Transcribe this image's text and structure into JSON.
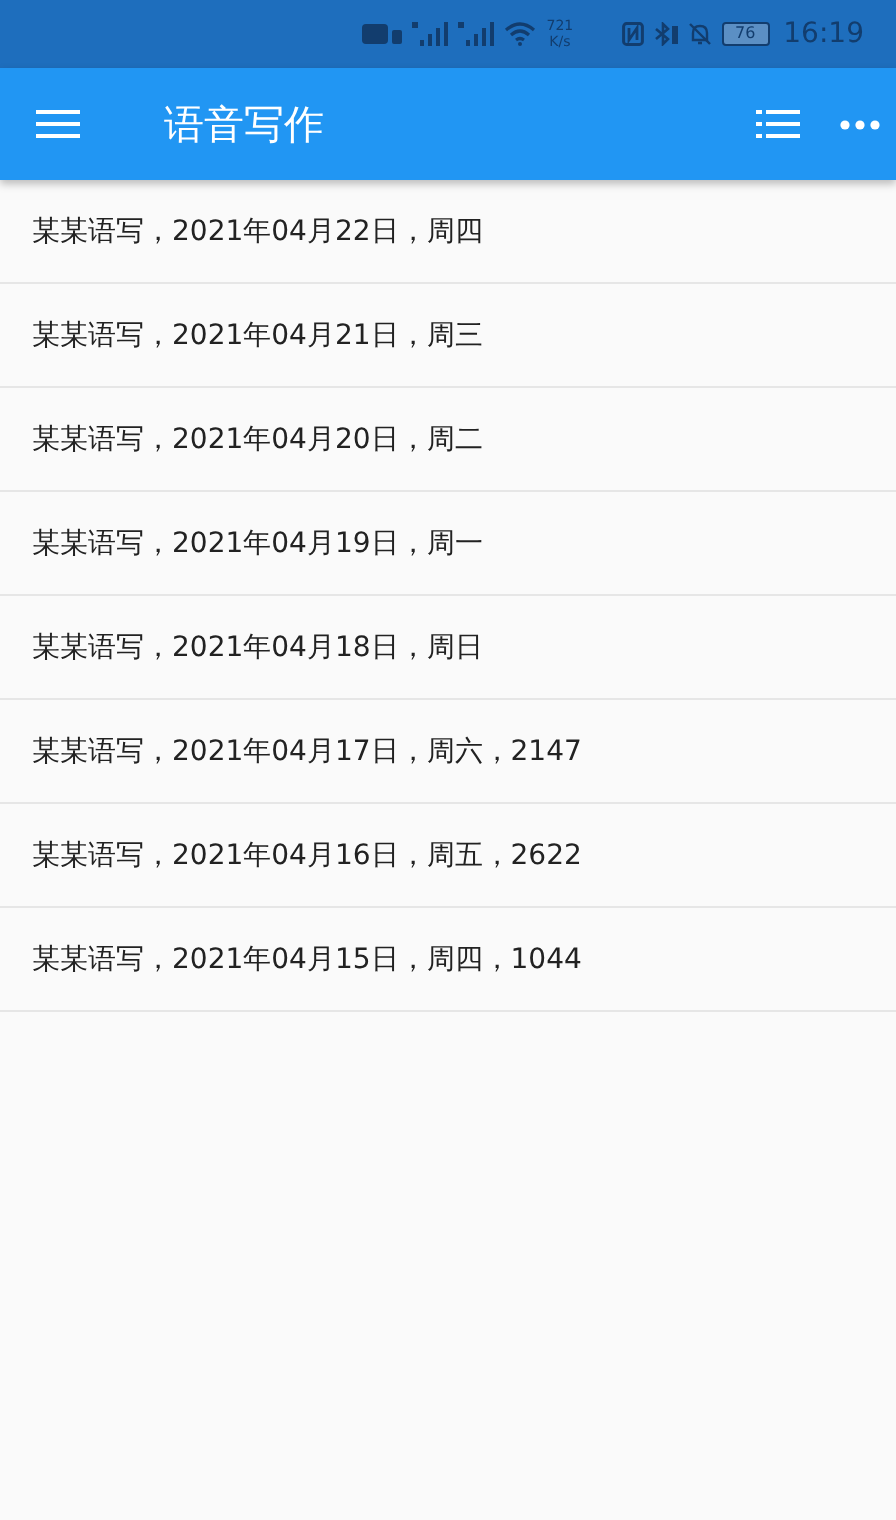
{
  "status_bar": {
    "speed_value": "721",
    "speed_unit": "K/s",
    "battery": "76",
    "time": "16:19"
  },
  "app_bar": {
    "title": "语音写作"
  },
  "entries": [
    {
      "text": "某某语写，2021年04月22日，周四"
    },
    {
      "text": "某某语写，2021年04月21日，周三"
    },
    {
      "text": "某某语写，2021年04月20日，周二"
    },
    {
      "text": "某某语写，2021年04月19日，周一"
    },
    {
      "text": "某某语写，2021年04月18日，周日"
    },
    {
      "text": "某某语写，2021年04月17日，周六，2147"
    },
    {
      "text": "某某语写，2021年04月16日，周五，2622"
    },
    {
      "text": "某某语写，2021年04月15日，周四，1044"
    }
  ]
}
